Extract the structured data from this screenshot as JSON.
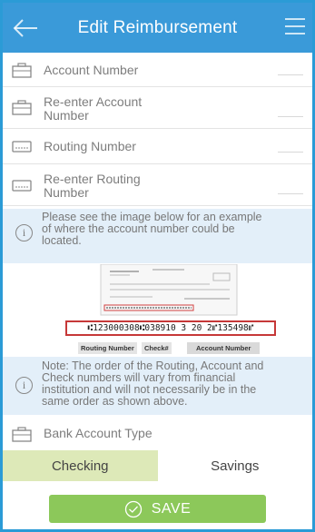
{
  "header": {
    "title": "Edit Reimbursement"
  },
  "fields": {
    "account_number": "Account Number",
    "reenter_account_number_1": "Re-enter Account",
    "reenter_account_number_2": "Number",
    "routing_number": "Routing Number",
    "reenter_routing_number_1": "Re-enter Routing",
    "reenter_routing_number_2": "Number",
    "bank_account_type": "Bank Account Type"
  },
  "info1": {
    "line1": "Please see the image below for an example",
    "line2": "of where the account number could be",
    "line3": "located."
  },
  "check_image": {
    "micr": "⑆123000308⑆038910 3 20 2⑈135498⑈",
    "routing_label": "Routing Number",
    "check_label": "Check#",
    "account_label": "Account Number"
  },
  "info2": {
    "line1": "Note: The order of the Routing, Account and",
    "line2": "Check numbers will vary from financial",
    "line3": "institution and will not necessarily be in the",
    "line4": "same order as shown above."
  },
  "account_type": {
    "options": [
      "Checking",
      "Savings"
    ],
    "selected": "Checking"
  },
  "save_label": "SAVE",
  "colors": {
    "header": "#3a9ad9",
    "border": "#2b9bd6",
    "save": "#8cc85a",
    "selected": "#dde9b8",
    "info_bg": "#e3eff9"
  }
}
